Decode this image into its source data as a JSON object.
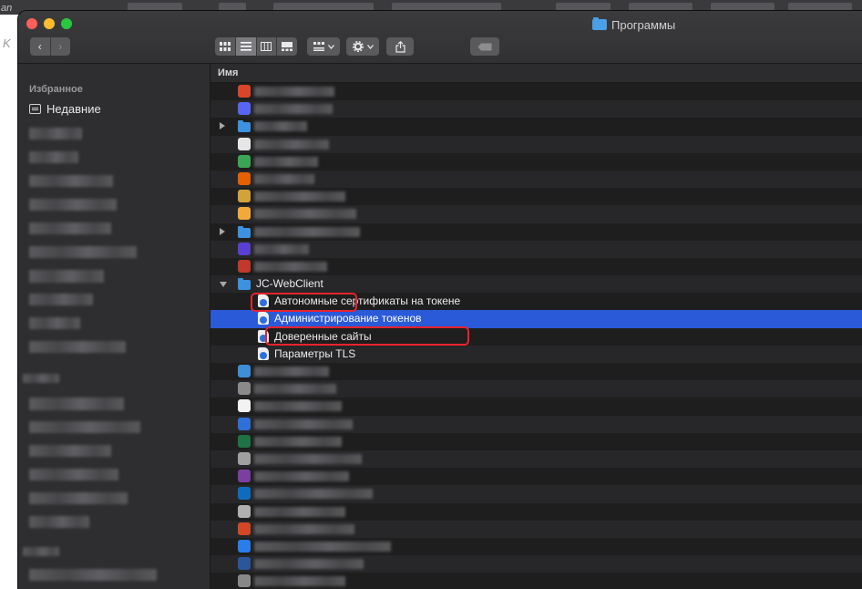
{
  "window": {
    "title": "Программы"
  },
  "background_fragments": {
    "char_top": "an",
    "char_left": "K"
  },
  "toolbar": {
    "back_glyph": "‹",
    "forward_glyph": "›"
  },
  "sidebar": {
    "heading": "Избранное",
    "recent_label": "Недавние"
  },
  "column": {
    "name_header": "Имя"
  },
  "rows": [
    {
      "kind": "app",
      "icon": "app-icon",
      "color": "#d8452a"
    },
    {
      "kind": "app",
      "icon": "app-icon",
      "color": "#5865f2"
    },
    {
      "kind": "folder",
      "icon": "folder-icon",
      "color": "#3c92df"
    },
    {
      "kind": "app",
      "icon": "app-icon",
      "color": "#e6e6e6"
    },
    {
      "kind": "app",
      "icon": "app-icon",
      "color": "#3aa655"
    },
    {
      "kind": "app",
      "icon": "app-icon",
      "color": "#e66000"
    },
    {
      "kind": "app",
      "icon": "app-icon",
      "color": "#d1a33b"
    },
    {
      "kind": "app",
      "icon": "app-icon",
      "color": "#f2a93b"
    },
    {
      "kind": "folder",
      "icon": "folder-icon",
      "color": "#3c92df"
    },
    {
      "kind": "app",
      "icon": "app-icon",
      "color": "#5b3fd1"
    },
    {
      "kind": "app",
      "icon": "app-icon",
      "color": "#c0392b"
    },
    {
      "kind": "folder-open",
      "icon": "folder-icon",
      "label": "JC-WebClient",
      "color": "#3c92df"
    },
    {
      "kind": "child",
      "icon": "webloc-icon",
      "label": "Автономные сертификаты на токене"
    },
    {
      "kind": "child",
      "icon": "webloc-icon",
      "label": "Администрирование токенов",
      "selected": true
    },
    {
      "kind": "child",
      "icon": "webloc-icon",
      "label": "Доверенные сайты"
    },
    {
      "kind": "child",
      "icon": "webloc-icon",
      "label": "Параметры TLS"
    },
    {
      "kind": "app",
      "icon": "app-icon",
      "color": "#3f8ed8"
    },
    {
      "kind": "app",
      "icon": "app-icon",
      "color": "#8a8a8a"
    },
    {
      "kind": "app",
      "icon": "app-icon",
      "color": "#f2f2f2"
    },
    {
      "kind": "app",
      "icon": "app-icon",
      "color": "#2f6fd6"
    },
    {
      "kind": "app",
      "icon": "app-icon",
      "color": "#1f7244"
    },
    {
      "kind": "app",
      "icon": "app-icon",
      "color": "#a0a0a0"
    },
    {
      "kind": "app",
      "icon": "app-icon",
      "color": "#7b3fa0"
    },
    {
      "kind": "app",
      "icon": "app-icon",
      "color": "#0f6cbd"
    },
    {
      "kind": "app",
      "icon": "app-icon",
      "color": "#b0b0b0"
    },
    {
      "kind": "app",
      "icon": "app-icon",
      "color": "#d24726"
    },
    {
      "kind": "app",
      "icon": "app-icon",
      "color": "#2b7de9"
    },
    {
      "kind": "app",
      "icon": "app-icon",
      "color": "#2b579a"
    },
    {
      "kind": "app",
      "icon": "app-icon",
      "color": "#888888"
    }
  ],
  "colors": {
    "selection": "#2a5ad8",
    "highlight_box": "#e8232e",
    "window_bg": "#1f1f1f"
  }
}
